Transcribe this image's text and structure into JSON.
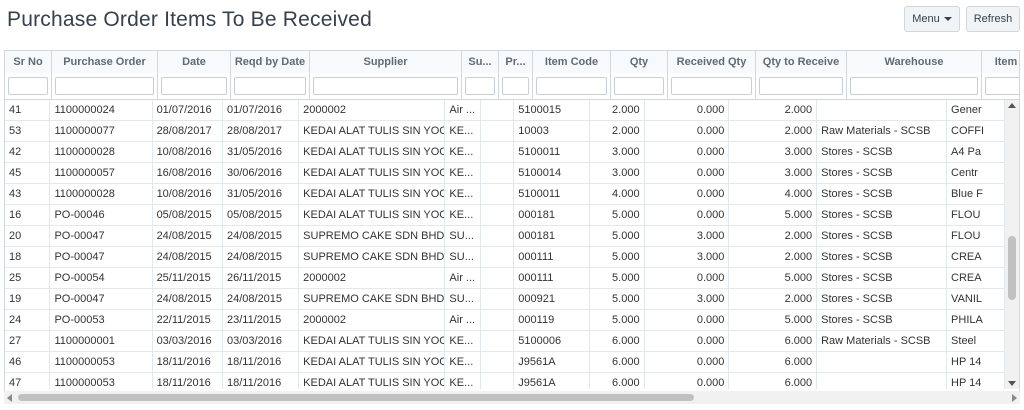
{
  "page": {
    "title": "Purchase Order Items To Be Received"
  },
  "toolbar": {
    "menu_label": "Menu",
    "refresh_label": "Refresh"
  },
  "columns": [
    "Sr No",
    "Purchase Order",
    "Date",
    "Reqd by Date",
    "Supplier",
    "Su...",
    "Pr...",
    "Item Code",
    "Qty",
    "Received Qty",
    "Qty to Receive",
    "Warehouse",
    "Item N"
  ],
  "rows": [
    [
      "41",
      "1100000024",
      "01/07/2016",
      "01/07/2016",
      "2000002",
      "Air ...",
      "",
      "5100015",
      "2.000",
      "0.000",
      "2.000",
      "",
      "Gener"
    ],
    [
      "53",
      "1100000077",
      "28/08/2017",
      "28/08/2017",
      "KEDAI ALAT TULIS SIN YOO...",
      "KE...",
      "",
      "10003",
      "2.000",
      "0.000",
      "2.000",
      "Raw Materials - SCSB",
      "COFFI"
    ],
    [
      "42",
      "1100000028",
      "10/08/2016",
      "31/05/2016",
      "KEDAI ALAT TULIS SIN YOO...",
      "KE...",
      "",
      "5100011",
      "3.000",
      "0.000",
      "3.000",
      "Stores - SCSB",
      "A4 Pa"
    ],
    [
      "45",
      "1100000057",
      "16/08/2016",
      "30/06/2016",
      "KEDAI ALAT TULIS SIN YOO...",
      "KE...",
      "",
      "5100014",
      "3.000",
      "0.000",
      "3.000",
      "Stores - SCSB",
      "Centr"
    ],
    [
      "43",
      "1100000028",
      "10/08/2016",
      "31/05/2016",
      "KEDAI ALAT TULIS SIN YOO...",
      "KE...",
      "",
      "5100011",
      "4.000",
      "0.000",
      "4.000",
      "Stores - SCSB",
      "Blue F"
    ],
    [
      "16",
      "PO-00046",
      "05/08/2015",
      "05/08/2015",
      "KEDAI ALAT TULIS SIN YOO...",
      "KE...",
      "",
      "000181",
      "5.000",
      "0.000",
      "5.000",
      "Stores - SCSB",
      "FLOU"
    ],
    [
      "20",
      "PO-00047",
      "24/08/2015",
      "24/08/2015",
      "SUPREMO CAKE SDN BHD",
      "SU...",
      "",
      "000181",
      "5.000",
      "3.000",
      "2.000",
      "Stores - SCSB",
      "FLOU"
    ],
    [
      "18",
      "PO-00047",
      "24/08/2015",
      "24/08/2015",
      "SUPREMO CAKE SDN BHD",
      "SU...",
      "",
      "000111",
      "5.000",
      "3.000",
      "2.000",
      "Stores - SCSB",
      "CREA"
    ],
    [
      "25",
      "PO-00054",
      "25/11/2015",
      "26/11/2015",
      "2000002",
      "Air ...",
      "",
      "000111",
      "5.000",
      "0.000",
      "5.000",
      "Stores - SCSB",
      "CREA"
    ],
    [
      "19",
      "PO-00047",
      "24/08/2015",
      "24/08/2015",
      "SUPREMO CAKE SDN BHD",
      "SU...",
      "",
      "000921",
      "5.000",
      "3.000",
      "2.000",
      "Stores - SCSB",
      "VANIL"
    ],
    [
      "24",
      "PO-00053",
      "22/11/2015",
      "23/11/2015",
      "2000002",
      "Air ...",
      "",
      "000119",
      "5.000",
      "0.000",
      "5.000",
      "Stores - SCSB",
      "PHILA"
    ],
    [
      "27",
      "1100000001",
      "03/03/2016",
      "03/03/2016",
      "KEDAI ALAT TULIS SIN YOO...",
      "KE...",
      "",
      "5100006",
      "6.000",
      "0.000",
      "6.000",
      "Raw Materials - SCSB",
      "Steel"
    ],
    [
      "46",
      "1100000053",
      "18/11/2016",
      "18/11/2016",
      "KEDAI ALAT TULIS SIN YOO...",
      "KE...",
      "",
      "J9561A",
      "6.000",
      "0.000",
      "6.000",
      "",
      "HP 14"
    ],
    [
      "47",
      "1100000053",
      "18/11/2016",
      "18/11/2016",
      "KEDAI ALAT TULIS SIN YOO...",
      "KE...",
      "",
      "J9561A",
      "6.000",
      "0.000",
      "6.000",
      "",
      "HP 14"
    ]
  ]
}
